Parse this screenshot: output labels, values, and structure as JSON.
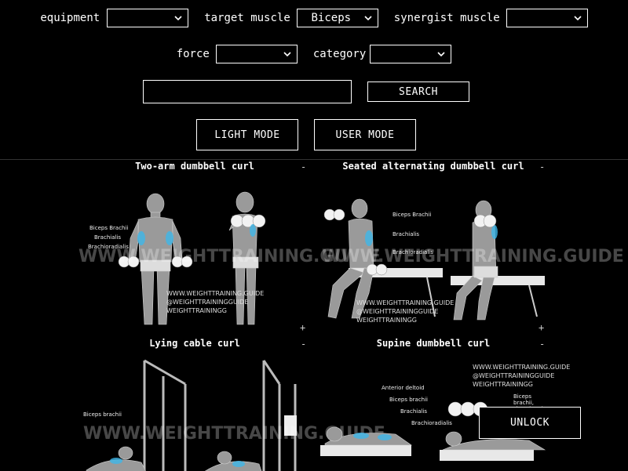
{
  "filters": {
    "equipment_label": "equipment",
    "equipment_value": "",
    "target_label": "target muscle",
    "target_value": "Biceps",
    "synergist_label": "synergist muscle",
    "synergist_value": "",
    "force_label": "force",
    "force_value": "",
    "category_label": "category",
    "category_value": ""
  },
  "search": {
    "value": "",
    "button_label": "SEARCH"
  },
  "modes": {
    "light_label": "LIGHT MODE",
    "user_label": "USER MODE"
  },
  "unlock_label": "UNLOCK",
  "cards": [
    {
      "title": "Two-arm dumbbell curl",
      "min": "-",
      "plus": "+",
      "labels": [
        "Biceps Brachii",
        "Brachialis",
        "Brachioradialis"
      ],
      "watermark": "WWW.WEIGHTTRAINING.GUIDE",
      "social": [
        "WWW.WEIGHTTRAINING.GUIDE",
        "@WEIGHTTRAININGGUIDE",
        "WEIGHTTRAININGG"
      ]
    },
    {
      "title": "Seated alternating dumbbell curl",
      "min": "-",
      "plus": "+",
      "labels": [
        "Biceps Brachii",
        "Brachialis",
        "Brachioradialis"
      ],
      "watermark": "WWW.WEIGHTTRAINING.GUIDE",
      "social": [
        "WWW.WEIGHTTRAINING.GUIDE",
        "@WEIGHTTRAININGGUIDE",
        "WEIGHTTRAININGG"
      ]
    },
    {
      "title": "Lying cable curl",
      "min": "-",
      "labels": [
        "Biceps brachii"
      ],
      "watermark": "WWW.WEIGHTTRAINING.GUIDE"
    },
    {
      "title": "Supine dumbbell curl",
      "min": "-",
      "labels": [
        "Anterior deltoid",
        "Biceps brachii",
        "Brachialis",
        "Brachioradialis",
        "Biceps brachii, short head"
      ],
      "social": [
        "WWW.WEIGHTTRAINING.GUIDE",
        "@WEIGHTTRAININGGUIDE",
        "WEIGHTTRAININGG"
      ]
    }
  ]
}
